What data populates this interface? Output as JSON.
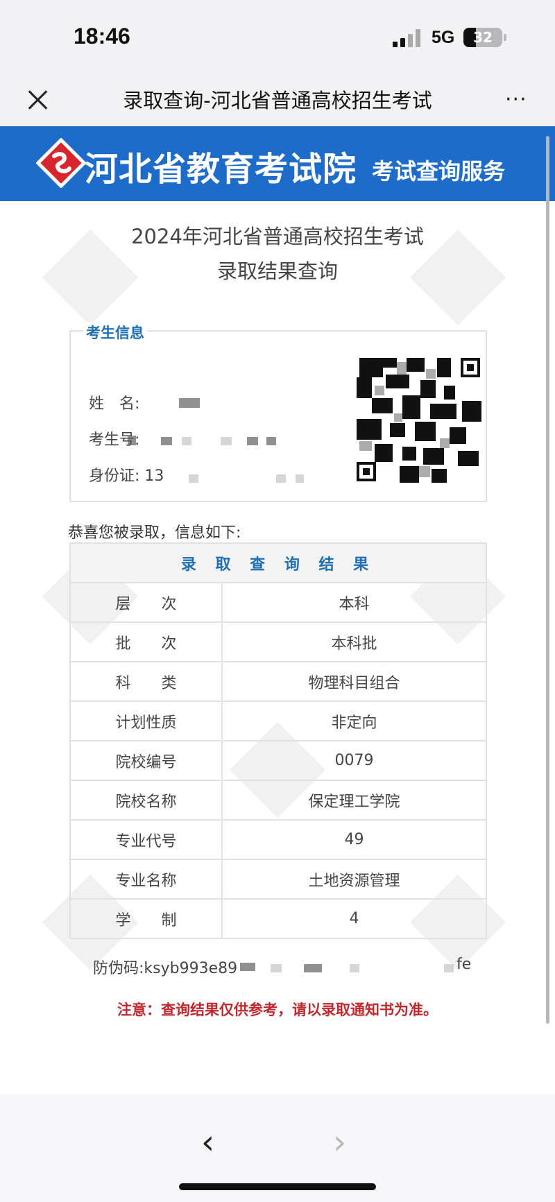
{
  "status_bar": {
    "time": "18:46",
    "network": "5G",
    "battery": "32"
  },
  "nav": {
    "title": "录取查询-河北省普通高校招生考试",
    "more": "···"
  },
  "banner": {
    "title": "河北省教育考试院",
    "subtitle": "考试查询服务"
  },
  "page": {
    "heading_line1": "2024年河北省普通高校招生考试",
    "heading_line2": "录取结果查询"
  },
  "info": {
    "legend": "考生信息",
    "name_label": "姓　名:",
    "exam_no_label": "考生号:",
    "id_label": "身份证: 13"
  },
  "congrats": "恭喜您被录取，信息如下:",
  "result": {
    "title": "录 取 查 询 结 果",
    "rows": [
      {
        "label": "层　　次",
        "value": "本科"
      },
      {
        "label": "批　　次",
        "value": "本科批"
      },
      {
        "label": "科　　类",
        "value": "物理科目组合"
      },
      {
        "label": "计划性质",
        "value": "非定向"
      },
      {
        "label": "院校编号",
        "value": "0079"
      },
      {
        "label": "院校名称",
        "value": "保定理工学院"
      },
      {
        "label": "专业代号",
        "value": "49"
      },
      {
        "label": "专业名称",
        "value": "土地资源管理"
      },
      {
        "label": "学　　制",
        "value": "4"
      }
    ]
  },
  "verify": {
    "prefix": "防伪码:ksyb993e89",
    "suffix": "fe"
  },
  "notice": "注意：查询结果仅供参考，请以录取通知书为准。",
  "toolbar": {
    "back": "‹",
    "forward": "›"
  }
}
